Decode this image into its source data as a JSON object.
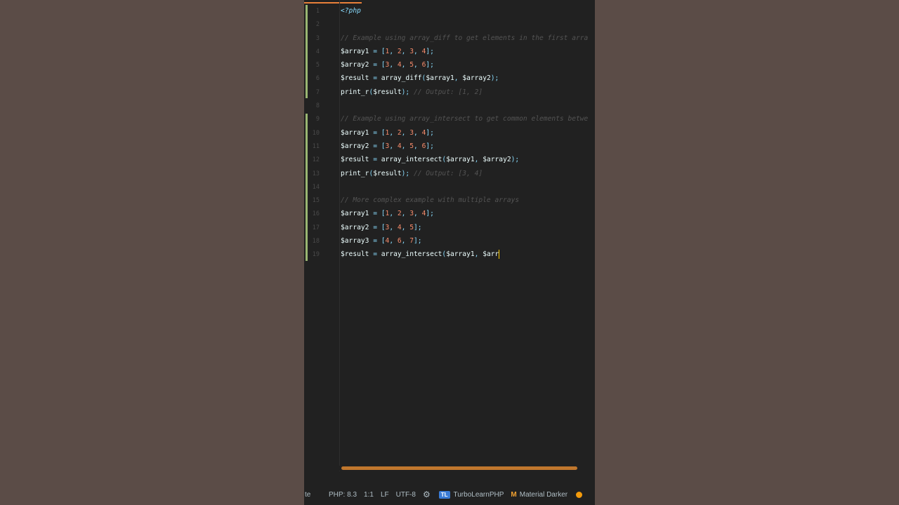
{
  "editor": {
    "lines": [
      {
        "n": "1",
        "tokens": [
          {
            "t": "<?php",
            "c": "tok-tag"
          }
        ]
      },
      {
        "n": "2",
        "tokens": []
      },
      {
        "n": "3",
        "tokens": [
          {
            "t": "// Example using array_diff to get elements in the first arra",
            "c": "tok-comment"
          }
        ]
      },
      {
        "n": "4",
        "tokens": [
          {
            "t": "$array1 ",
            "c": "tok-var"
          },
          {
            "t": "= [",
            "c": "tok-punct"
          },
          {
            "t": "1",
            "c": "tok-num"
          },
          {
            "t": ", ",
            "c": "tok-punct"
          },
          {
            "t": "2",
            "c": "tok-num"
          },
          {
            "t": ", ",
            "c": "tok-punct"
          },
          {
            "t": "3",
            "c": "tok-num"
          },
          {
            "t": ", ",
            "c": "tok-punct"
          },
          {
            "t": "4",
            "c": "tok-num"
          },
          {
            "t": "];",
            "c": "tok-punct"
          }
        ]
      },
      {
        "n": "5",
        "tokens": [
          {
            "t": "$array2 ",
            "c": "tok-var"
          },
          {
            "t": "= [",
            "c": "tok-punct"
          },
          {
            "t": "3",
            "c": "tok-num"
          },
          {
            "t": ", ",
            "c": "tok-punct"
          },
          {
            "t": "4",
            "c": "tok-num"
          },
          {
            "t": ", ",
            "c": "tok-punct"
          },
          {
            "t": "5",
            "c": "tok-num"
          },
          {
            "t": ", ",
            "c": "tok-punct"
          },
          {
            "t": "6",
            "c": "tok-num"
          },
          {
            "t": "];",
            "c": "tok-punct"
          }
        ]
      },
      {
        "n": "6",
        "tokens": [
          {
            "t": "$result ",
            "c": "tok-var"
          },
          {
            "t": "= ",
            "c": "tok-punct"
          },
          {
            "t": "array_diff",
            "c": "tok-fn"
          },
          {
            "t": "(",
            "c": "tok-punct"
          },
          {
            "t": "$array1",
            "c": "tok-var"
          },
          {
            "t": ", ",
            "c": "tok-punct"
          },
          {
            "t": "$array2",
            "c": "tok-var"
          },
          {
            "t": ");",
            "c": "tok-punct"
          }
        ]
      },
      {
        "n": "7",
        "tokens": [
          {
            "t": "print_r",
            "c": "tok-fn"
          },
          {
            "t": "(",
            "c": "tok-punct"
          },
          {
            "t": "$result",
            "c": "tok-var"
          },
          {
            "t": "); ",
            "c": "tok-punct"
          },
          {
            "t": "// Output: [1, 2]",
            "c": "tok-comment"
          }
        ]
      },
      {
        "n": "8",
        "tokens": []
      },
      {
        "n": "9",
        "tokens": [
          {
            "t": "// Example using array_intersect to get common elements betwe",
            "c": "tok-comment"
          }
        ]
      },
      {
        "n": "10",
        "tokens": [
          {
            "t": "$array1 ",
            "c": "tok-var"
          },
          {
            "t": "= [",
            "c": "tok-punct"
          },
          {
            "t": "1",
            "c": "tok-num"
          },
          {
            "t": ", ",
            "c": "tok-punct"
          },
          {
            "t": "2",
            "c": "tok-num"
          },
          {
            "t": ", ",
            "c": "tok-punct"
          },
          {
            "t": "3",
            "c": "tok-num"
          },
          {
            "t": ", ",
            "c": "tok-punct"
          },
          {
            "t": "4",
            "c": "tok-num"
          },
          {
            "t": "];",
            "c": "tok-punct"
          }
        ]
      },
      {
        "n": "11",
        "tokens": [
          {
            "t": "$array2 ",
            "c": "tok-var"
          },
          {
            "t": "= [",
            "c": "tok-punct"
          },
          {
            "t": "3",
            "c": "tok-num"
          },
          {
            "t": ", ",
            "c": "tok-punct"
          },
          {
            "t": "4",
            "c": "tok-num"
          },
          {
            "t": ", ",
            "c": "tok-punct"
          },
          {
            "t": "5",
            "c": "tok-num"
          },
          {
            "t": ", ",
            "c": "tok-punct"
          },
          {
            "t": "6",
            "c": "tok-num"
          },
          {
            "t": "];",
            "c": "tok-punct"
          }
        ]
      },
      {
        "n": "12",
        "tokens": [
          {
            "t": "$result ",
            "c": "tok-var"
          },
          {
            "t": "= ",
            "c": "tok-punct"
          },
          {
            "t": "array_intersect",
            "c": "tok-fn"
          },
          {
            "t": "(",
            "c": "tok-punct"
          },
          {
            "t": "$array1",
            "c": "tok-var"
          },
          {
            "t": ", ",
            "c": "tok-punct"
          },
          {
            "t": "$array2",
            "c": "tok-var"
          },
          {
            "t": ");",
            "c": "tok-punct"
          }
        ]
      },
      {
        "n": "13",
        "tokens": [
          {
            "t": "print_r",
            "c": "tok-fn"
          },
          {
            "t": "(",
            "c": "tok-punct"
          },
          {
            "t": "$result",
            "c": "tok-var"
          },
          {
            "t": "); ",
            "c": "tok-punct"
          },
          {
            "t": "// Output: [3, 4]",
            "c": "tok-comment"
          }
        ]
      },
      {
        "n": "14",
        "tokens": []
      },
      {
        "n": "15",
        "tokens": [
          {
            "t": "// More complex example with multiple arrays",
            "c": "tok-comment"
          }
        ]
      },
      {
        "n": "16",
        "tokens": [
          {
            "t": "$array1 ",
            "c": "tok-var"
          },
          {
            "t": "= [",
            "c": "tok-punct"
          },
          {
            "t": "1",
            "c": "tok-num"
          },
          {
            "t": ", ",
            "c": "tok-punct"
          },
          {
            "t": "2",
            "c": "tok-num"
          },
          {
            "t": ", ",
            "c": "tok-punct"
          },
          {
            "t": "3",
            "c": "tok-num"
          },
          {
            "t": ", ",
            "c": "tok-punct"
          },
          {
            "t": "4",
            "c": "tok-num"
          },
          {
            "t": "];",
            "c": "tok-punct"
          }
        ]
      },
      {
        "n": "17",
        "tokens": [
          {
            "t": "$array2 ",
            "c": "tok-var"
          },
          {
            "t": "= [",
            "c": "tok-punct"
          },
          {
            "t": "3",
            "c": "tok-num"
          },
          {
            "t": ", ",
            "c": "tok-punct"
          },
          {
            "t": "4",
            "c": "tok-num"
          },
          {
            "t": ", ",
            "c": "tok-punct"
          },
          {
            "t": "5",
            "c": "tok-num"
          },
          {
            "t": "];",
            "c": "tok-punct"
          }
        ]
      },
      {
        "n": "18",
        "tokens": [
          {
            "t": "$array3 ",
            "c": "tok-var"
          },
          {
            "t": "= [",
            "c": "tok-punct"
          },
          {
            "t": "4",
            "c": "tok-num"
          },
          {
            "t": ", ",
            "c": "tok-punct"
          },
          {
            "t": "6",
            "c": "tok-num"
          },
          {
            "t": ", ",
            "c": "tok-punct"
          },
          {
            "t": "7",
            "c": "tok-num"
          },
          {
            "t": "];",
            "c": "tok-punct"
          }
        ]
      },
      {
        "n": "19",
        "tokens": [
          {
            "t": "$result ",
            "c": "tok-var"
          },
          {
            "t": "= ",
            "c": "tok-punct"
          },
          {
            "t": "array_intersect",
            "c": "tok-fn"
          },
          {
            "t": "(",
            "c": "tok-punct"
          },
          {
            "t": "$array1",
            "c": "tok-var"
          },
          {
            "t": ", ",
            "c": "tok-punct"
          },
          {
            "t": "$arr",
            "c": "tok-var"
          }
        ],
        "caret": true
      }
    ]
  },
  "statusbar": {
    "truncated": "te",
    "php_version": "PHP: 8.3",
    "cursor_pos": "1:1",
    "line_ending": "LF",
    "encoding": "UTF-8",
    "plugin_badge": "TL",
    "plugin_name": "TurboLearnPHP",
    "theme_name": "Material Darker",
    "theme_icon": "M"
  },
  "colors": {
    "accent": "#e8803a",
    "status_dot": "#f49b0b",
    "vcs_modified": "#c3e88d"
  }
}
